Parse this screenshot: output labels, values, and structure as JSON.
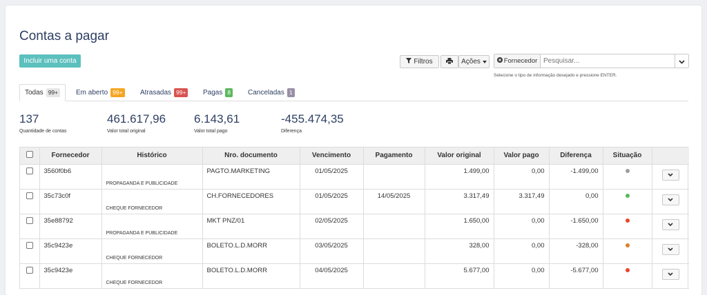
{
  "page": {
    "title": "Contas a pagar"
  },
  "toolbar": {
    "include_label": "Incluir uma conta",
    "filters_label": "Filtros",
    "actions_label": "Ações",
    "search_addon_label": "Fornecedor",
    "search_placeholder": "Pesquisar...",
    "hint": "Selecione o tipo de informação desejado e pressione ENTER."
  },
  "tabs": [
    {
      "label": "Todas",
      "count": "99+",
      "color": "#e6e6e6",
      "text_color": "#333333"
    },
    {
      "label": "Em aberto",
      "count": "99+",
      "color": "#f5a623",
      "text_color": "#ffffff"
    },
    {
      "label": "Atrasadas",
      "count": "99+",
      "color": "#d9534f",
      "text_color": "#ffffff"
    },
    {
      "label": "Pagas",
      "count": "8",
      "color": "#5cb85c",
      "text_color": "#ffffff"
    },
    {
      "label": "Canceladas",
      "count": "1",
      "color": "#9a8fa6",
      "text_color": "#ffffff"
    }
  ],
  "stats": [
    {
      "value": "137",
      "label": "Quantidade de contas"
    },
    {
      "value": "461.617,96",
      "label": "Valor total original"
    },
    {
      "value": "6.143,61",
      "label": "Valor total pago"
    },
    {
      "value": "-455.474,35",
      "label": "Diferença"
    }
  ],
  "table": {
    "headers": [
      "Fornecedor",
      "Histórico",
      "Nro. documento",
      "Vencimento",
      "Pagamento",
      "Valor original",
      "Valor pago",
      "Diferença",
      "Situação"
    ],
    "rows": [
      {
        "fornecedor": "3560f0b6",
        "historico": "PROPAGANDA E PUBLICIDADE",
        "documento": "PAGTO.MARKETING",
        "vencimento": "01/05/2025",
        "pagamento": "",
        "valor_original": "1.499,00",
        "valor_pago": "0,00",
        "diferenca": "-1.499,00",
        "situacao_color": "#9e9e9e"
      },
      {
        "fornecedor": "35c73c0f",
        "historico": "CHEQUE FORNECEDOR",
        "documento": "CH.FORNECEDORES",
        "vencimento": "01/05/2025",
        "pagamento": "14/05/2025",
        "valor_original": "3.317,49",
        "valor_pago": "3.317,49",
        "diferenca": "0,00",
        "situacao_color": "#5cb85c"
      },
      {
        "fornecedor": "35e88792",
        "historico": "PROPAGANDA E PUBLICIDADE",
        "documento": "MKT PNZ/01",
        "vencimento": "02/05/2025",
        "pagamento": "",
        "valor_original": "1.650,00",
        "valor_pago": "0,00",
        "diferenca": "-1.650,00",
        "situacao_color": "#e8462f"
      },
      {
        "fornecedor": "35c9423e",
        "historico": "CHEQUE FORNECEDOR",
        "documento": "BOLETO.L.D.MORR",
        "vencimento": "03/05/2025",
        "pagamento": "",
        "valor_original": "328,00",
        "valor_pago": "0,00",
        "diferenca": "-328,00",
        "situacao_color": "#d9822b"
      },
      {
        "fornecedor": "35c9423e",
        "historico": "CHEQUE FORNECEDOR",
        "documento": "BOLETO.L.D.MORR",
        "vencimento": "04/05/2025",
        "pagamento": "",
        "valor_original": "5.677,00",
        "valor_pago": "0,00",
        "diferenca": "-5.677,00",
        "situacao_color": "#e8462f"
      }
    ]
  }
}
